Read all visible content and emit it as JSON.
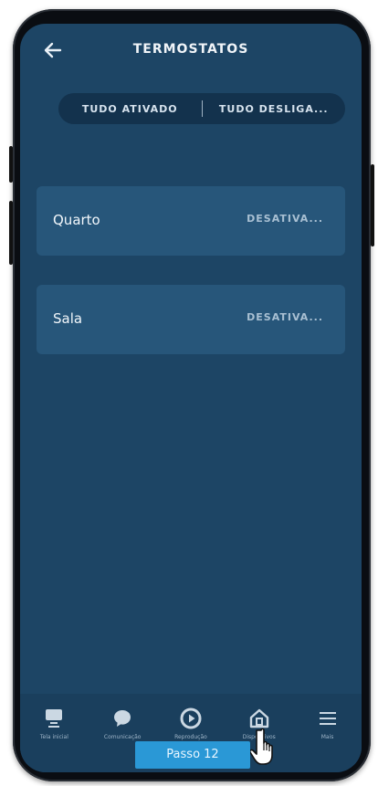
{
  "header": {
    "title": "TERMOSTATOS",
    "back_icon": "arrow-left-icon"
  },
  "toggle": {
    "all_on": "TUDO ATIVADO",
    "all_off": "TUDO DESLIGA..."
  },
  "devices": [
    {
      "name": "Quarto",
      "action": "DESATIVA..."
    },
    {
      "name": "Sala",
      "action": "DESATIVA..."
    }
  ],
  "nav": [
    {
      "label": "Tela inicial",
      "icon": "home-screen-icon"
    },
    {
      "label": "Comunicação",
      "icon": "chat-bubble-icon"
    },
    {
      "label": "Reprodução",
      "icon": "play-icon"
    },
    {
      "label": "Dispositivos",
      "icon": "devices-home-icon"
    },
    {
      "label": "Mais",
      "icon": "menu-icon"
    }
  ],
  "overlay": {
    "step_label": "Passo 12"
  },
  "colors": {
    "screen_bg": "#1d4565",
    "card_bg": "#27567a",
    "accent": "#2a98d6"
  }
}
